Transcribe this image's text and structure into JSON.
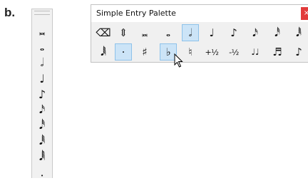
{
  "figure_label": "b.",
  "window": {
    "title": "Simple Entry Palette",
    "close_glyph": "×",
    "accent_selected": "#cce4f7",
    "close_color": "#e23b3b"
  },
  "vertical_palette": {
    "items": [
      {
        "glyph": "𝅜",
        "name": "double-whole-note-icon"
      },
      {
        "glyph": "𝅝",
        "name": "whole-note-icon"
      },
      {
        "glyph": "𝅗𝅥",
        "name": "half-note-icon"
      },
      {
        "glyph": "♩",
        "name": "quarter-note-icon"
      },
      {
        "glyph": "♪",
        "name": "eighth-note-icon"
      },
      {
        "glyph": "𝅘𝅥𝅯",
        "name": "sixteenth-note-icon"
      },
      {
        "glyph": "𝅘𝅥𝅰",
        "name": "thirty-second-note-icon"
      },
      {
        "glyph": "𝅘𝅥𝅱",
        "name": "sixty-fourth-note-icon"
      },
      {
        "glyph": "𝅘𝅥𝅲",
        "name": "one-twenty-eighth-note-icon"
      },
      {
        "glyph": "·",
        "name": "augmentation-dot-icon"
      }
    ]
  },
  "toolbar": {
    "row1": [
      {
        "glyph": "⌫",
        "name": "eraser-icon",
        "selected": false
      },
      {
        "glyph": "⇕",
        "name": "move-updown-icon",
        "selected": false
      },
      {
        "glyph": "𝅜",
        "name": "double-whole-note-icon",
        "selected": false
      },
      {
        "glyph": "𝅝",
        "name": "whole-note-icon",
        "selected": false
      },
      {
        "glyph": "𝅗𝅥",
        "name": "half-note-icon",
        "selected": true
      },
      {
        "glyph": "♩",
        "name": "quarter-note-icon",
        "selected": false
      },
      {
        "glyph": "♪",
        "name": "eighth-note-icon",
        "selected": false
      },
      {
        "glyph": "𝅘𝅥𝅯",
        "name": "sixteenth-note-icon",
        "selected": false
      },
      {
        "glyph": "𝅘𝅥𝅰",
        "name": "thirty-second-note-icon",
        "selected": false
      },
      {
        "glyph": "𝅘𝅥𝅱",
        "name": "sixty-fourth-note-icon",
        "selected": false
      }
    ],
    "row2": [
      {
        "glyph": "𝅘𝅥𝅲",
        "name": "one-twenty-eighth-note-icon",
        "selected": false
      },
      {
        "glyph": "·",
        "name": "augmentation-dot-icon",
        "selected": true
      },
      {
        "glyph": "♯",
        "name": "sharp-icon",
        "selected": false
      },
      {
        "glyph": "♭",
        "name": "flat-icon",
        "selected": true
      },
      {
        "glyph": "♮",
        "name": "natural-icon",
        "selected": false
      },
      {
        "glyph": "+½",
        "name": "raise-half-step-button",
        "selected": false
      },
      {
        "glyph": "-½",
        "name": "lower-half-step-button",
        "selected": false
      },
      {
        "glyph": "♩♩",
        "name": "tie-icon",
        "selected": false
      },
      {
        "glyph": "♬",
        "name": "tuplet-icon",
        "selected": false
      },
      {
        "glyph": "♪",
        "name": "grace-note-icon",
        "selected": false
      }
    ]
  }
}
